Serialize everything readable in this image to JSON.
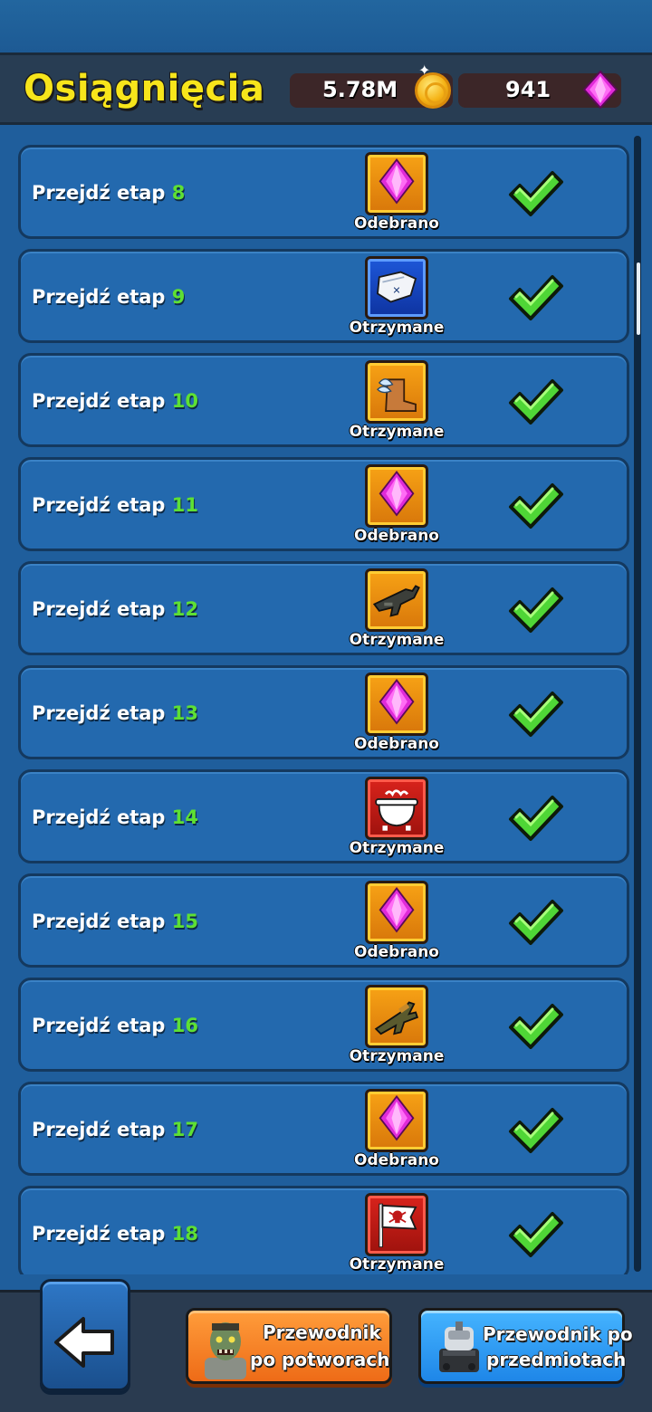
{
  "header": {
    "title": "Osiągnięcia",
    "coins": "5.78M",
    "gems": "941"
  },
  "colors": {
    "title": "#f7e51b",
    "stage_number": "#5ee033",
    "row_bg": "#2369ae",
    "check": "#4fd636"
  },
  "rows": [
    {
      "label": "Przejdź etap",
      "num": "8",
      "reward_icon": "gem-icon",
      "frame": "orange",
      "status": "Odebrano"
    },
    {
      "label": "Przejdź etap",
      "num": "9",
      "reward_icon": "scroll-map-icon",
      "frame": "blue",
      "status": "Otrzymane"
    },
    {
      "label": "Przejdź etap",
      "num": "10",
      "reward_icon": "winged-boot-icon",
      "frame": "orange",
      "status": "Otrzymane"
    },
    {
      "label": "Przejdź etap",
      "num": "11",
      "reward_icon": "gem-icon",
      "frame": "orange",
      "status": "Odebrano"
    },
    {
      "label": "Przejdź etap",
      "num": "12",
      "reward_icon": "smg-gun-icon",
      "frame": "orange",
      "status": "Otrzymane"
    },
    {
      "label": "Przejdź etap",
      "num": "13",
      "reward_icon": "gem-icon",
      "frame": "orange",
      "status": "Odebrano"
    },
    {
      "label": "Przejdź etap",
      "num": "14",
      "reward_icon": "cauldron-icon",
      "frame": "red",
      "status": "Otrzymane"
    },
    {
      "label": "Przejdź etap",
      "num": "15",
      "reward_icon": "gem-icon",
      "frame": "orange",
      "status": "Odebrano"
    },
    {
      "label": "Przejdź etap",
      "num": "16",
      "reward_icon": "rifle-gun-icon",
      "frame": "orange",
      "status": "Otrzymane"
    },
    {
      "label": "Przejdź etap",
      "num": "17",
      "reward_icon": "gem-icon",
      "frame": "orange",
      "status": "Odebrano"
    },
    {
      "label": "Przejdź etap",
      "num": "18",
      "reward_icon": "pirate-flag-icon",
      "frame": "red",
      "status": "Otrzymane"
    }
  ],
  "footer": {
    "back_icon": "arrow-left-icon",
    "monsters_guide_line1": "Przewodnik",
    "monsters_guide_line2": "po potworach",
    "items_guide_line1": "Przewodnik po",
    "items_guide_line2": "przedmiotach"
  }
}
